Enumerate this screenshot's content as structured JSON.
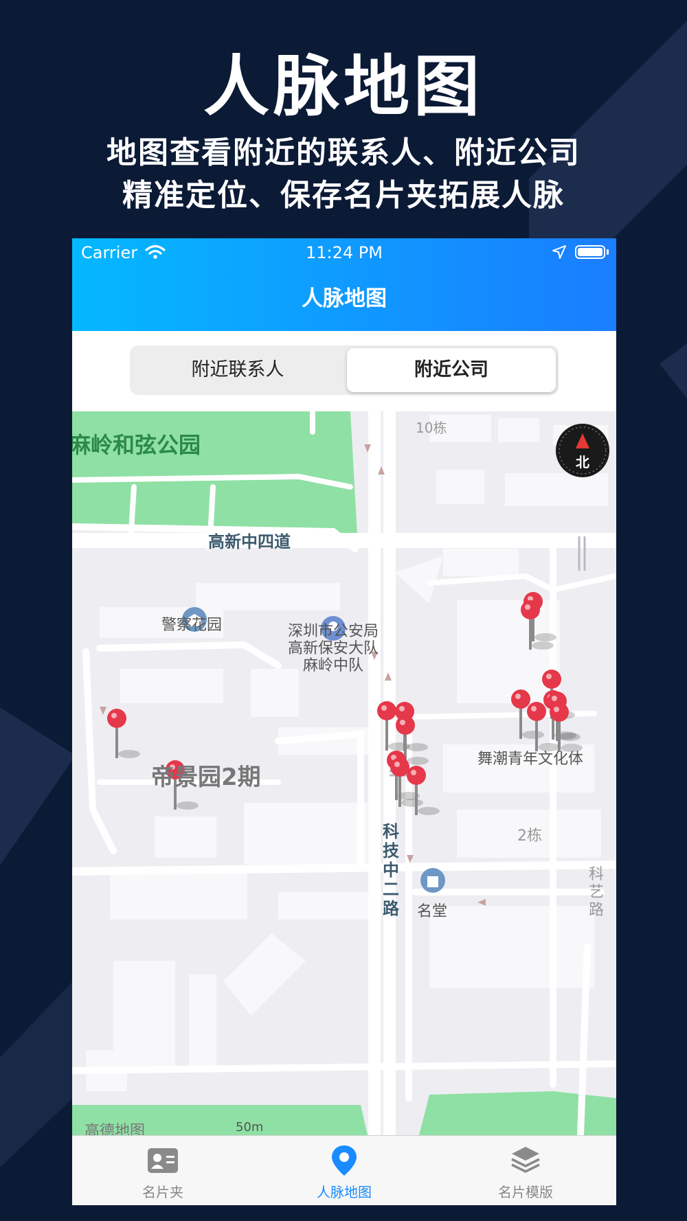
{
  "promo": {
    "title": "人脉地图",
    "subtitle_line1": "地图查看附近的联系人、附近公司",
    "subtitle_line2": "精准定位、保存名片夹拓展人脉"
  },
  "status_bar": {
    "carrier": "Carrier",
    "time": "11:24 PM",
    "icons": [
      "wifi-icon",
      "location-arrow-icon",
      "battery-icon"
    ]
  },
  "nav": {
    "title": "人脉地图"
  },
  "segment": {
    "options": [
      "附近联系人",
      "附近公司"
    ],
    "selected": "附近公司"
  },
  "map": {
    "labels": {
      "park": "麻岭和弦公园",
      "building_10": "10栋",
      "road_gaoxin4": "高新中四道",
      "police_garden": "警察花园",
      "police_line1": "深圳市公安局",
      "police_line2": "高新保安大队",
      "police_line3": "麻岭中队",
      "diyuan": "帝景园2期",
      "wuchao": "舞潮青年文化体",
      "building_2": "2栋",
      "mingtang": "名堂",
      "road_keji": "科技中二路",
      "road_keyi": "科艺路",
      "amap": "高德地图",
      "scale": "50m"
    },
    "compass_label": "北",
    "pin_count": 16,
    "colors": {
      "park": "#8fe0a4",
      "pin": "#e5384a",
      "road": "#ffffff",
      "block": "#f8f8fa"
    }
  },
  "tabbar": {
    "tabs": [
      {
        "label": "名片夹",
        "icon": "contact-card-icon",
        "active": false
      },
      {
        "label": "人脉地图",
        "icon": "map-pin-icon",
        "active": true
      },
      {
        "label": "名片模版",
        "icon": "layers-icon",
        "active": false
      }
    ]
  },
  "colors": {
    "background": "#0b1a35",
    "accent": "#1a8cff",
    "header_start": "#04b8ff",
    "header_end": "#1a7dff"
  }
}
